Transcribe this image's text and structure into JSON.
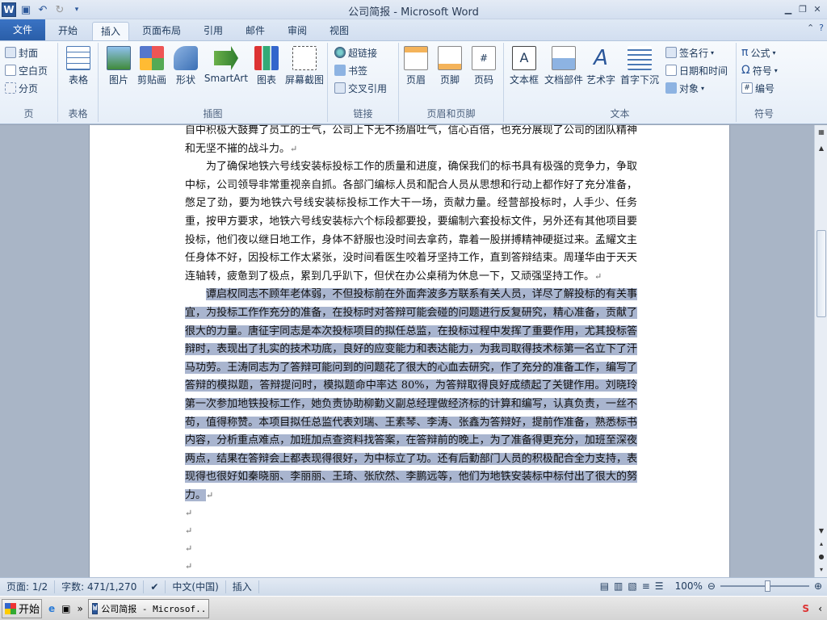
{
  "window": {
    "title": "公司简报 - Microsoft Word"
  },
  "tabs": [
    "文件",
    "开始",
    "插入",
    "页面布局",
    "引用",
    "邮件",
    "审阅",
    "视图"
  ],
  "ribbon": {
    "pages": {
      "items": [
        "封面",
        "空白页",
        "分页"
      ],
      "label": "页"
    },
    "tables": {
      "table": "表格",
      "label": "表格"
    },
    "illustrations": {
      "items": [
        "图片",
        "剪贴画",
        "形状",
        "SmartArt",
        "图表",
        "屏幕截图"
      ],
      "label": "插图"
    },
    "links": {
      "items": [
        "超链接",
        "书签",
        "交叉引用"
      ],
      "label": "链接"
    },
    "header_footer": {
      "items": [
        "页眉",
        "页脚",
        "页码"
      ],
      "label": "页眉和页脚"
    },
    "text": {
      "items": [
        "文本框",
        "文档部件",
        "艺术字",
        "首字下沉"
      ],
      "small": [
        "签名行",
        "日期和时间",
        "对象"
      ],
      "label": "文本"
    },
    "symbols": {
      "items": [
        "公式",
        "符号",
        "编号"
      ],
      "label": "符号"
    }
  },
  "document": {
    "line0": "自中积极大鼓舞了员工的士气，公司上下无不扬眉吐气，信心百倍，也充分展现了公司的团",
    "p1_end": "队精神和无坚不摧的战斗力。",
    "p2": "为了确保地铁六号线安装标投标工作的质量和进度，确保我们的标书具有极强的竞争力，争取中标，公司领导非常重视亲自抓。各部门编标人员和配合人员从思想和行动上都作好了充分准备，憋足了劲，要为地铁六号线安装标投标工作大干一场，贡献力量。经营部投标时，人手少、任务重，按甲方要求，地铁六号线安装标六个标段都要投，要编制六套投标文件，另外还有其他项目要投标，他们夜以继日地工作，身体不舒服也没时间去拿药，靠着一股拼搏精神硬挺过来。孟耀文主任身体不好，因投标工作太紧张，没时间看医生咬着牙坚持工作，直到答辩结束。周瑾华由于天天连轴转，疲惫到了极点，累到几乎趴下，但伏在办公桌稍为休息一下，又顽强坚持工作。",
    "p3": "谭启权同志不顾年老体弱，不但投标前在外面奔波多方联系有关人员，详尽了解投标的有关事宜，为投标工作作充分的准备，在投标时对答辩可能会碰的问题进行反复研究，精心准备，贡献了很大的力量。唐征宇同志是本次投标项目的拟任总监，在投标过程中发挥了重要作用，尤其投标答辩时，表现出了扎实的技术功底，良好的应变能力和表达能力，为我司取得技术标第一名立下了汗马功劳。王涛同志为了答辩可能问到的问题花了很大的心血去研究，作了充分的准备工作，编写了答辩的模拟题，答辩提问时，模拟题命中率达 80%，为答辩取得良好成绩起了关键作用。刘晓玲第一次参加地铁投标工作，她负责协助柳勤义副总经理做经济标的计算和编写，认真负责，一丝不苟，值得称赞。本项目拟任总监代表刘瑞、王素琴、李涛、张鑫为答辩好，提前作准备，熟悉标书内容，分析重点难点，加班加点查资料找答案，在答辩前的晚上，为了准备得更充分，加班至深夜两点，结果在答辩会上都表现得很好，为中标立了功。还有后勤部门人员的积极配合全力支持，表现得也很好如秦晓丽、李丽丽、王琦、张欣然、李鹏远等，他们为地铁安装标中标付出了很大的努力。",
    "para_mark": "↵"
  },
  "status": {
    "page": "页面: 1/2",
    "words": "字数: 471/1,270",
    "lang": "中文(中国)",
    "mode": "插入",
    "zoom": "100%",
    "zoom_fraction": 0.5
  },
  "taskbar": {
    "start": "开始",
    "task": "公司简报 - Microsof..."
  }
}
